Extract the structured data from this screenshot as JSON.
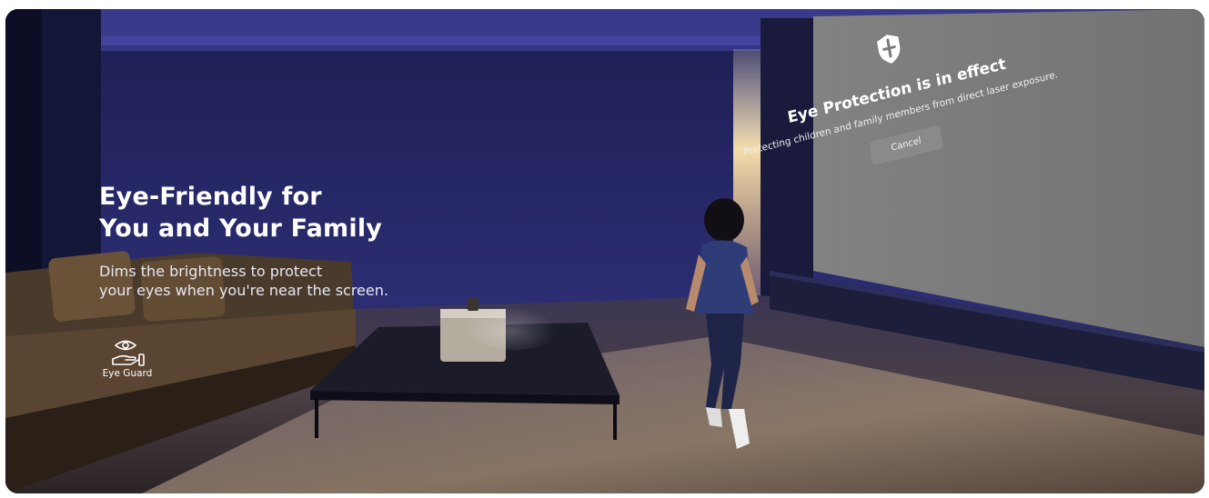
{
  "hero": {
    "headline_line1": "Eye-Friendly for",
    "headline_line2": "You and Your Family",
    "subtext_line1": "Dims the brightness to protect",
    "subtext_line2": "your eyes when you're near the screen."
  },
  "feature": {
    "icon": "eye-guard-icon",
    "label": "Eye Guard"
  },
  "projected_screen": {
    "icon": "shield-icon",
    "title": "Eye Protection is in effect",
    "subtitle": "Protecting children and family members from direct laser exposure.",
    "cancel_label": "Cancel"
  },
  "colors": {
    "room_wall": "#2a2b6a",
    "screen_gray": "#7b7b7b",
    "floor": "#3a3340",
    "text": "#ffffff"
  }
}
